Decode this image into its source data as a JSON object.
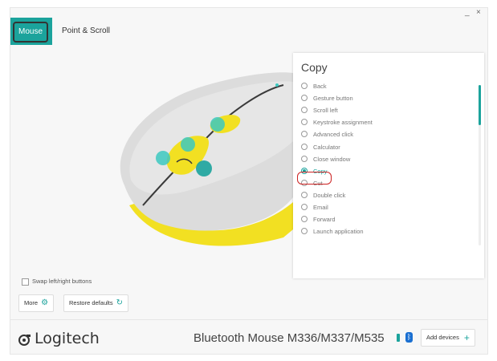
{
  "window": {
    "minimize_label": "_",
    "close_label": "×"
  },
  "tabs": {
    "mouse_label": "Mouse",
    "point_scroll_label": "Point & Scroll"
  },
  "panel": {
    "title": "Copy",
    "options": [
      {
        "label": "Back",
        "selected": false
      },
      {
        "label": "Gesture button",
        "selected": false
      },
      {
        "label": "Scroll left",
        "selected": false
      },
      {
        "label": "Keystroke assignment",
        "selected": false
      },
      {
        "label": "Advanced click",
        "selected": false
      },
      {
        "label": "Calculator",
        "selected": false
      },
      {
        "label": "Close window",
        "selected": false
      },
      {
        "label": "Copy",
        "selected": true
      },
      {
        "label": "Cut",
        "selected": false
      },
      {
        "label": "Double click",
        "selected": false
      },
      {
        "label": "Email",
        "selected": false
      },
      {
        "label": "Forward",
        "selected": false
      },
      {
        "label": "Launch application",
        "selected": false
      }
    ]
  },
  "controls": {
    "swap_label": "Swap left/right buttons",
    "more_label": "More",
    "restore_label": "Restore defaults"
  },
  "footer": {
    "brand": "Logitech",
    "device_name": "Bluetooth Mouse M336/M337/M535",
    "add_devices_label": "Add devices"
  },
  "colors": {
    "accent": "#1ba39c",
    "mouse_yellow": "#f2e022",
    "highlight_red": "#cc2222"
  }
}
